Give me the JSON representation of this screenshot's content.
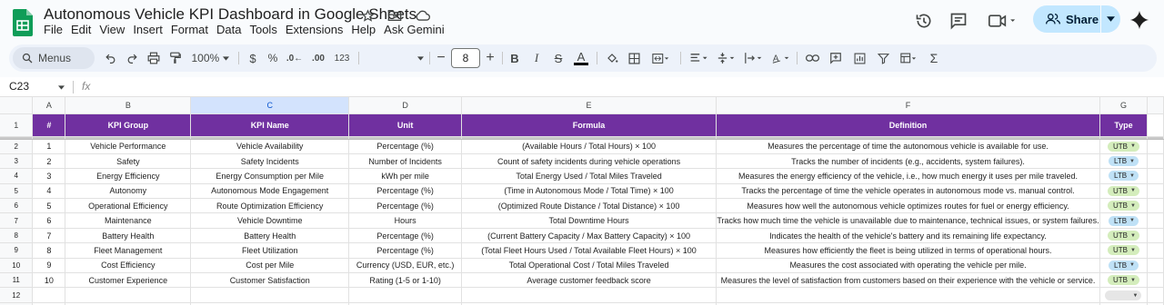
{
  "app": {
    "title": "Autonomous Vehicle KPI Dashboard in Google Sheets",
    "menu": [
      "File",
      "Edit",
      "View",
      "Insert",
      "Format",
      "Data",
      "Tools",
      "Extensions",
      "Help",
      "Ask Gemini"
    ],
    "share_label": "Share"
  },
  "toolbar": {
    "menus_label": "Menus",
    "zoom": "100%",
    "currency": "$",
    "percent": "%",
    "decrease_decimal": ".0←",
    "increase_decimal": ".00",
    "number_format": "123",
    "font_size": "8"
  },
  "formula_bar": {
    "cell_ref": "C23",
    "fx_label": "fx"
  },
  "sheet": {
    "columns": [
      "A",
      "B",
      "C",
      "D",
      "E",
      "F",
      "G"
    ],
    "selected_column": "C",
    "header_row": [
      "#",
      "KPI Group",
      "KPI Name",
      "Unit",
      "Formula",
      "Definition",
      "Type"
    ],
    "rows": [
      {
        "num": "1",
        "group": "Vehicle Performance",
        "name": "Vehicle Availability",
        "unit": "Percentage (%)",
        "formula": "(Available Hours / Total Hours) × 100",
        "definition": "Measures the percentage of time the autonomous vehicle is available for use.",
        "type": "UTB"
      },
      {
        "num": "2",
        "group": "Safety",
        "name": "Safety Incidents",
        "unit": "Number of Incidents",
        "formula": "Count of safety incidents during vehicle operations",
        "definition": "Tracks the number of incidents (e.g., accidents, system failures).",
        "type": "LTB"
      },
      {
        "num": "3",
        "group": "Energy Efficiency",
        "name": "Energy Consumption per Mile",
        "unit": "kWh per mile",
        "formula": "Total Energy Used / Total Miles Traveled",
        "definition": "Measures the energy efficiency of the vehicle, i.e., how much energy it uses per mile traveled.",
        "type": "LTB"
      },
      {
        "num": "4",
        "group": "Autonomy",
        "name": "Autonomous Mode Engagement",
        "unit": "Percentage (%)",
        "formula": "(Time in Autonomous Mode / Total Time) × 100",
        "definition": "Tracks the percentage of time the vehicle operates in autonomous mode vs. manual control.",
        "type": "UTB"
      },
      {
        "num": "5",
        "group": "Operational Efficiency",
        "name": "Route Optimization Efficiency",
        "unit": "Percentage (%)",
        "formula": "(Optimized Route Distance / Total Distance) × 100",
        "definition": "Measures how well the autonomous vehicle optimizes routes for fuel or energy efficiency.",
        "type": "UTB"
      },
      {
        "num": "6",
        "group": "Maintenance",
        "name": "Vehicle Downtime",
        "unit": "Hours",
        "formula": "Total Downtime Hours",
        "definition": "Tracks how much time the vehicle is unavailable due to maintenance, technical issues, or system failures.",
        "type": "LTB"
      },
      {
        "num": "7",
        "group": "Battery Health",
        "name": "Battery Health",
        "unit": "Percentage (%)",
        "formula": "(Current Battery Capacity / Max Battery Capacity) × 100",
        "definition": "Indicates the health of the vehicle's battery and its remaining life expectancy.",
        "type": "UTB"
      },
      {
        "num": "8",
        "group": "Fleet Management",
        "name": "Fleet Utilization",
        "unit": "Percentage (%)",
        "formula": "(Total Fleet Hours Used / Total Available Fleet Hours) × 100",
        "definition": "Measures how efficiently the fleet is being utilized in terms of operational hours.",
        "type": "UTB"
      },
      {
        "num": "9",
        "group": "Cost Efficiency",
        "name": "Cost per Mile",
        "unit": "Currency (USD, EUR, etc.)",
        "formula": "Total Operational Cost / Total Miles Traveled",
        "definition": "Measures the cost associated with operating the vehicle per mile.",
        "type": "LTB"
      },
      {
        "num": "10",
        "group": "Customer Experience",
        "name": "Customer Satisfaction",
        "unit": "Rating (1-5 or 1-10)",
        "formula": "Average customer feedback score",
        "definition": "Measures the level of satisfaction from customers based on their experience with the vehicle or service.",
        "type": "UTB"
      }
    ],
    "row_numbers": [
      "1",
      "2",
      "3",
      "4",
      "5",
      "6",
      "7",
      "8",
      "9",
      "10",
      "11",
      "12"
    ]
  },
  "colors": {
    "header_fill": "#7030a0",
    "utb_chip": "#d4edbc",
    "ltb_chip": "#bfe1f6",
    "share_button": "#c2e7ff"
  }
}
